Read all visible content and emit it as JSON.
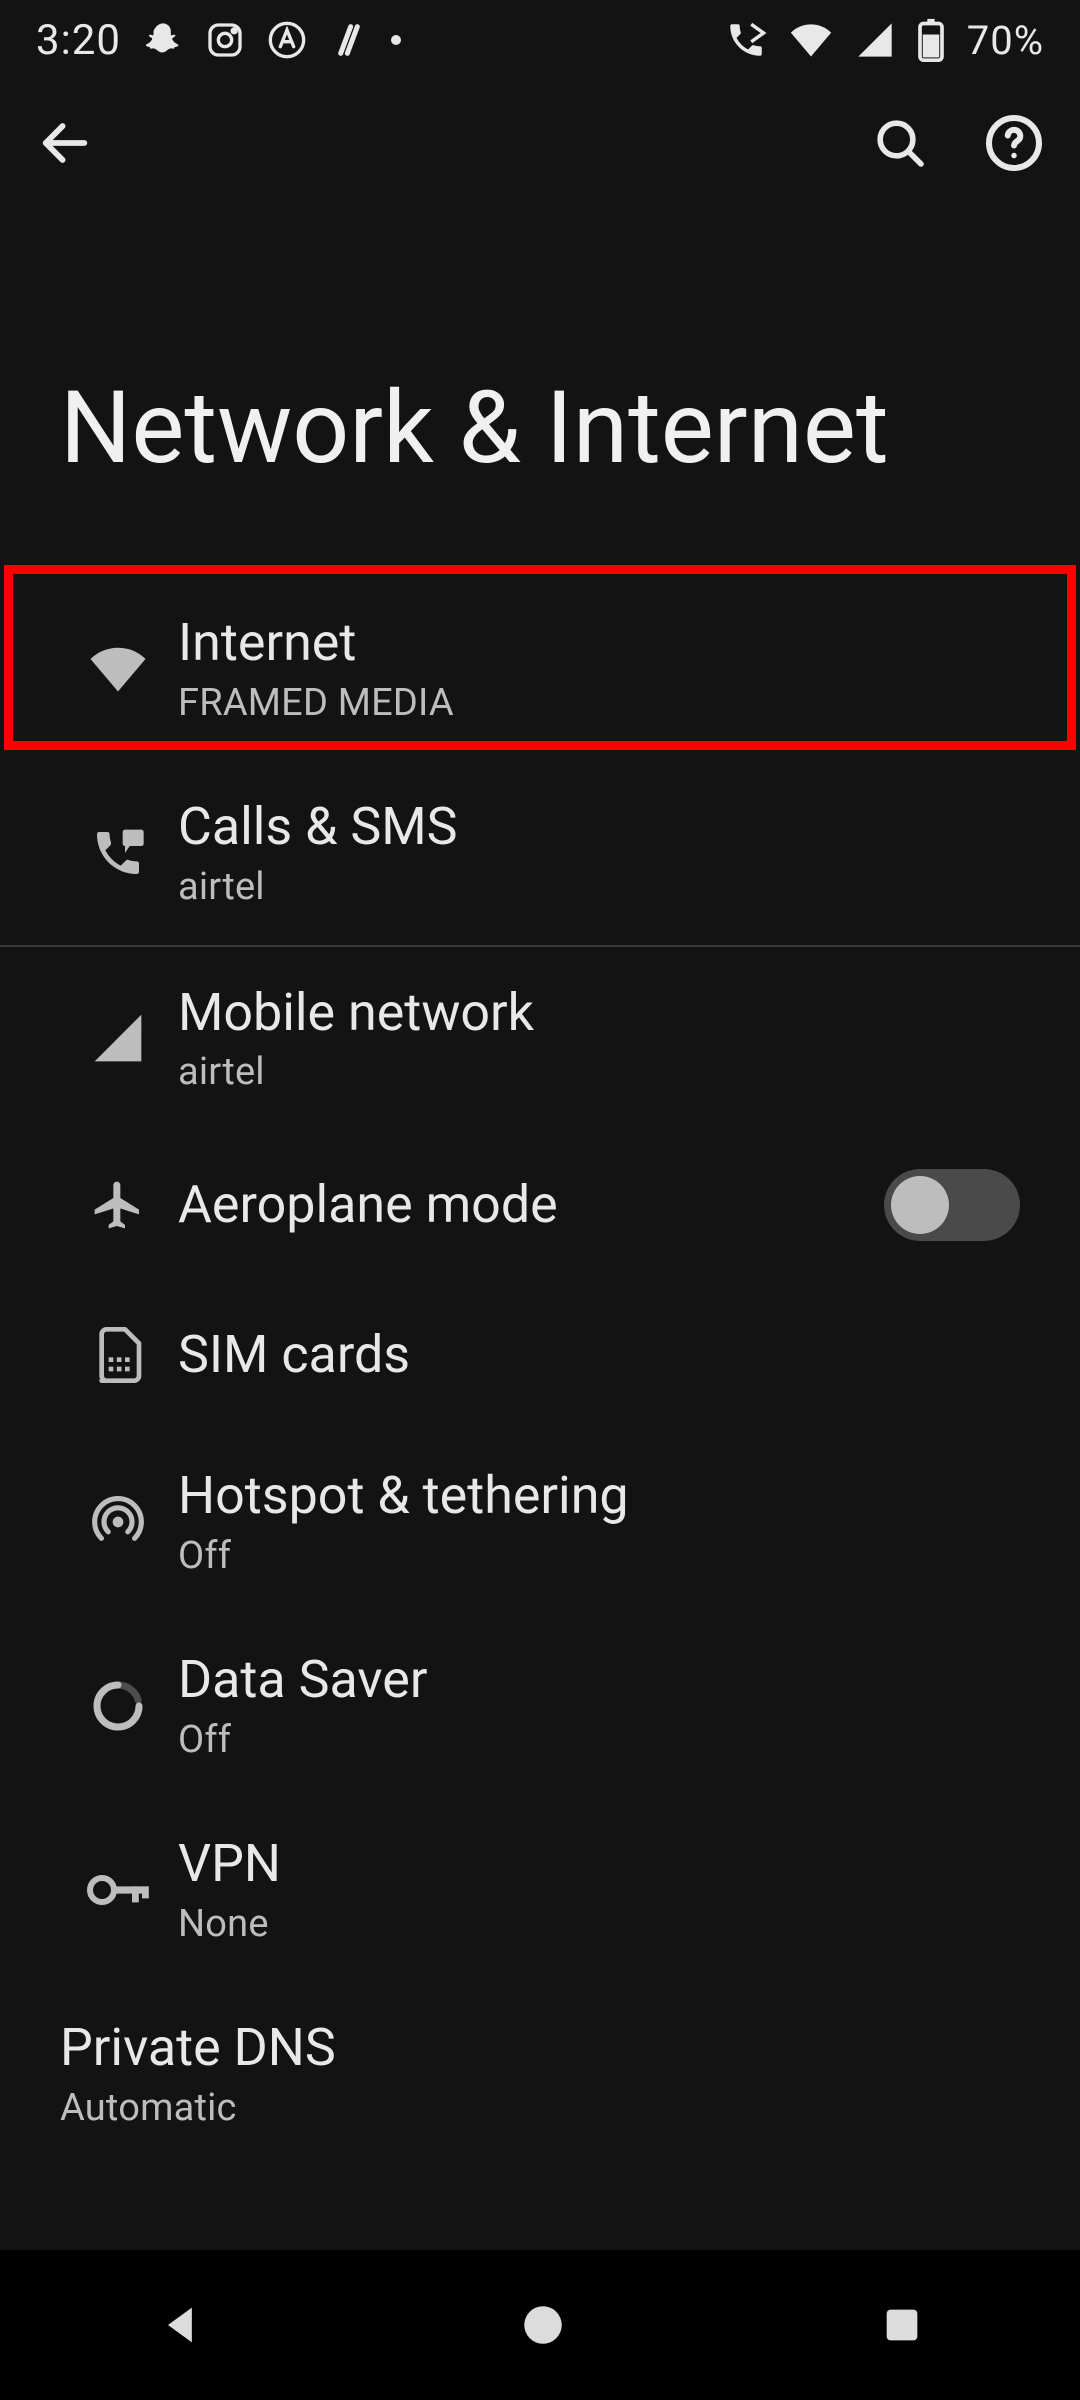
{
  "status": {
    "time": "3:20",
    "battery_pct": "70%"
  },
  "page": {
    "title": "Network & Internet"
  },
  "items": {
    "internet": {
      "title": "Internet",
      "sub": "FRAMED MEDIA"
    },
    "calls": {
      "title": "Calls & SMS",
      "sub": "airtel"
    },
    "mobile": {
      "title": "Mobile network",
      "sub": "airtel"
    },
    "airplane": {
      "title": "Aeroplane mode"
    },
    "sim": {
      "title": "SIM cards"
    },
    "hotspot": {
      "title": "Hotspot & tethering",
      "sub": "Off"
    },
    "datasaver": {
      "title": "Data Saver",
      "sub": "Off"
    },
    "vpn": {
      "title": "VPN",
      "sub": "None"
    },
    "dns": {
      "title": "Private DNS",
      "sub": "Automatic"
    }
  },
  "toggles": {
    "airplane": false
  }
}
